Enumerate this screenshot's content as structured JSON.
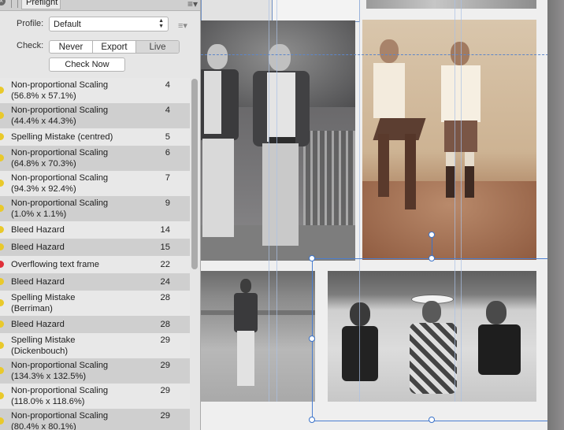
{
  "panel": {
    "tab_label": "Preflight",
    "profile_label": "Profile:",
    "profile_value": "Default",
    "check_label": "Check:",
    "check_options": [
      "Never",
      "Export",
      "Live"
    ],
    "check_now_label": "Check Now"
  },
  "issues": [
    {
      "line1": "Non-proportional Scaling",
      "line2": "(56.8% x 57.1%)",
      "page": "4",
      "severity": "warning"
    },
    {
      "line1": "Non-proportional Scaling",
      "line2": "(44.4% x 44.3%)",
      "page": "4",
      "severity": "warning"
    },
    {
      "line1": "Spelling Mistake (centred)",
      "line2": "",
      "page": "5",
      "severity": "warning"
    },
    {
      "line1": "Non-proportional Scaling",
      "line2": "(64.8% x 70.3%)",
      "page": "6",
      "severity": "warning"
    },
    {
      "line1": "Non-proportional Scaling",
      "line2": "(94.3% x 92.4%)",
      "page": "7",
      "severity": "warning"
    },
    {
      "line1": "Non-proportional Scaling",
      "line2": "(1.0% x 1.1%)",
      "page": "9",
      "severity": "warning"
    },
    {
      "line1": "Bleed Hazard",
      "line2": "",
      "page": "14",
      "severity": "warning"
    },
    {
      "line1": "Bleed Hazard",
      "line2": "",
      "page": "15",
      "severity": "warning"
    },
    {
      "line1": "Overflowing text frame",
      "line2": "",
      "page": "22",
      "severity": "error"
    },
    {
      "line1": "Bleed Hazard",
      "line2": "",
      "page": "24",
      "severity": "warning"
    },
    {
      "line1": "Spelling Mistake",
      "line2": "(Berriman)",
      "page": "28",
      "severity": "warning"
    },
    {
      "line1": "Bleed Hazard",
      "line2": "",
      "page": "28",
      "severity": "warning"
    },
    {
      "line1": "Spelling Mistake",
      "line2": "(Dickenbouch)",
      "page": "29",
      "severity": "warning"
    },
    {
      "line1": "Non-proportional Scaling",
      "line2": "(134.3% x 132.5%)",
      "page": "29",
      "severity": "warning"
    },
    {
      "line1": "Non-proportional Scaling",
      "line2": "(118.0% x 118.6%)",
      "page": "29",
      "severity": "warning"
    },
    {
      "line1": "Non-proportional Scaling",
      "line2": "(80.4% x 80.1%)",
      "page": "29",
      "severity": "warning"
    }
  ],
  "colors": {
    "warning": "#e9c92b",
    "error": "#e0303a",
    "selection": "#3b73c9"
  },
  "icons": [
    "close-icon",
    "grip-icon",
    "panel-menu-icon",
    "stepper-arrows-icon",
    "profile-options-icon"
  ]
}
